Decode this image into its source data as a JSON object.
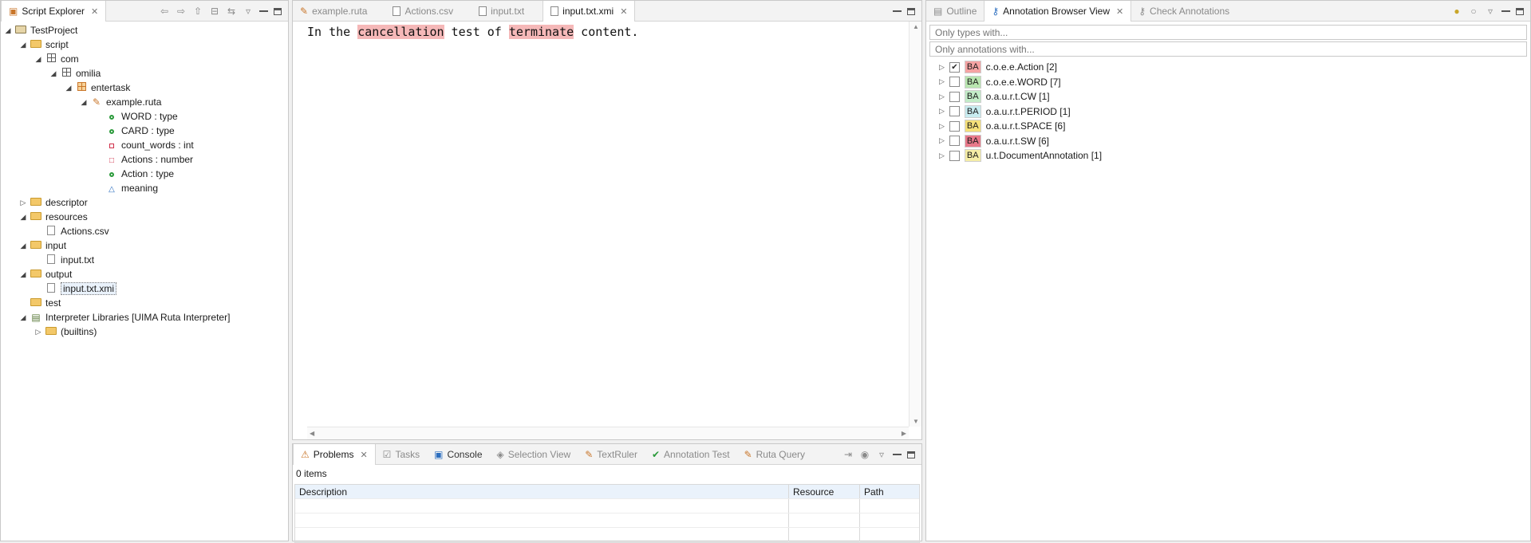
{
  "script_explorer": {
    "tab": "Script Explorer",
    "tree": [
      {
        "label": "TestProject",
        "icon": "project-icon",
        "level": 0,
        "expanded": true
      },
      {
        "label": "script",
        "icon": "folder-icon",
        "level": 1,
        "expanded": true
      },
      {
        "label": "com",
        "icon": "package-icon",
        "level": 2,
        "expanded": true
      },
      {
        "label": "omilia",
        "icon": "package-icon",
        "level": 3,
        "expanded": true
      },
      {
        "label": "entertask",
        "icon": "package-orange-icon",
        "level": 4,
        "expanded": true
      },
      {
        "label": "example.ruta",
        "icon": "ruta-file-icon",
        "level": 5,
        "expanded": true
      },
      {
        "label": "WORD : type",
        "icon": "type-icon",
        "level": 6
      },
      {
        "label": "CARD : type",
        "icon": "type-icon",
        "level": 6
      },
      {
        "label": "count_words : int",
        "icon": "int-icon",
        "level": 6
      },
      {
        "label": "Actions : number",
        "icon": "number-icon",
        "level": 6
      },
      {
        "label": "Action : type",
        "icon": "type-icon",
        "level": 6
      },
      {
        "label": "meaning",
        "icon": "triangle-icon",
        "level": 6
      },
      {
        "label": "descriptor",
        "icon": "folder-icon",
        "level": 1,
        "expanded": false
      },
      {
        "label": "resources",
        "icon": "folder-icon",
        "level": 1,
        "expanded": true
      },
      {
        "label": "Actions.csv",
        "icon": "file-icon",
        "level": 2
      },
      {
        "label": "input",
        "icon": "folder-icon",
        "level": 1,
        "expanded": true
      },
      {
        "label": "input.txt",
        "icon": "file-icon",
        "level": 2
      },
      {
        "label": "output",
        "icon": "folder-icon",
        "level": 1,
        "expanded": true
      },
      {
        "label": "input.txt.xmi",
        "icon": "file-icon",
        "level": 2,
        "selected": true
      },
      {
        "label": "test",
        "icon": "folder-icon",
        "level": 1
      },
      {
        "label": "Interpreter Libraries [UIMA Ruta Interpreter]",
        "icon": "library-icon",
        "level": 1,
        "expanded": true
      },
      {
        "label": "(builtins)",
        "icon": "folder-icon",
        "level": 2,
        "expanded": false
      }
    ]
  },
  "editor": {
    "tabs": [
      {
        "label": "example.ruta",
        "active": false
      },
      {
        "label": "Actions.csv",
        "active": false
      },
      {
        "label": "input.txt",
        "active": false
      },
      {
        "label": "input.txt.xmi",
        "active": true
      }
    ],
    "text_segments": [
      {
        "text": "In the ",
        "highlight": false
      },
      {
        "text": "cancellation",
        "highlight": true
      },
      {
        "text": " test of ",
        "highlight": false
      },
      {
        "text": "terminate",
        "highlight": true
      },
      {
        "text": " content.",
        "highlight": false
      }
    ]
  },
  "annotation_browser": {
    "tabs": [
      "Outline",
      "Annotation Browser View",
      "Check Annotations"
    ],
    "active_tab": "Annotation Browser View",
    "type_filter_placeholder": "Only types with...",
    "annotation_filter_placeholder": "Only annotations with...",
    "items": [
      {
        "label": "c.o.e.e.Action [2]",
        "checked": true,
        "color": "#f5a3a3"
      },
      {
        "label": "c.o.e.e.WORD [7]",
        "checked": false,
        "color": "#b9e6b0"
      },
      {
        "label": "o.a.u.r.t.CW [1]",
        "checked": false,
        "color": "#c3ecc8"
      },
      {
        "label": "o.a.u.r.t.PERIOD [1]",
        "checked": false,
        "color": "#c8ecf0"
      },
      {
        "label": "o.a.u.r.t.SPACE [6]",
        "checked": false,
        "color": "#f5e07a"
      },
      {
        "label": "o.a.u.r.t.SW [6]",
        "checked": false,
        "color": "#e8798a"
      },
      {
        "label": "u.t.DocumentAnnotation [1]",
        "checked": false,
        "color": "#f5eda6"
      }
    ],
    "badge": "BA"
  },
  "problems": {
    "tabs": [
      "Problems",
      "Tasks",
      "Console",
      "Selection View",
      "TextRuler",
      "Annotation Test",
      "Ruta Query"
    ],
    "active_tab": "Problems",
    "count": "0 items",
    "columns": [
      "Description",
      "Resource",
      "Path"
    ]
  }
}
